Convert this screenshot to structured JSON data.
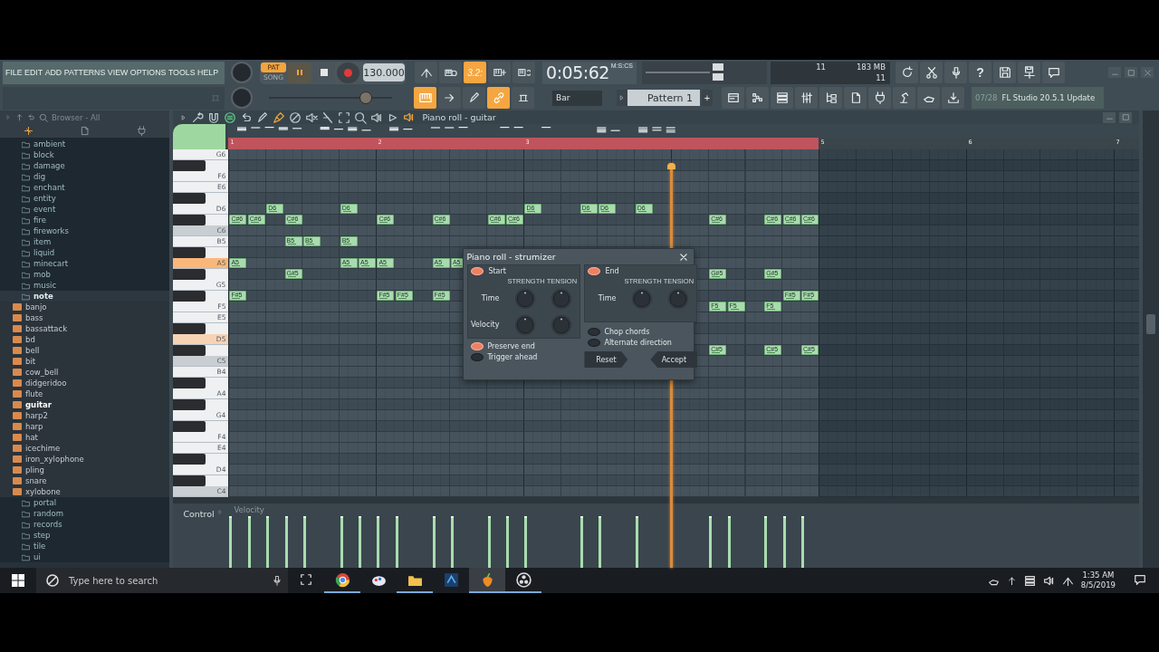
{
  "toolbar": {
    "menu": [
      "FILE",
      "EDIT",
      "ADD",
      "PATTERNS",
      "VIEW",
      "OPTIONS",
      "TOOLS",
      "HELP"
    ],
    "modes": [
      {
        "label": "PAT",
        "selected": true
      },
      {
        "label": "SONG",
        "selected": false
      }
    ],
    "playing": true,
    "tempo": "130.000",
    "toggles_top": [
      {
        "on": false
      },
      {
        "on": false
      },
      {
        "on": true,
        "label": "3.2:"
      },
      {
        "on": false
      },
      {
        "on": false
      }
    ],
    "time": {
      "value": "0:05:62",
      "unit": "M:S:CS"
    },
    "monitor": {
      "polyphony": "11",
      "memory": "183 MB",
      "voices": "11"
    },
    "help_label": "?",
    "master_pitch": {
      "level": 0.78
    },
    "toggles_bottom": [
      {
        "on": true
      },
      {
        "on": false
      },
      {
        "on": false
      },
      {
        "on": true
      },
      {
        "on": false
      }
    ],
    "snap": "Bar",
    "pattern": "Pattern 1",
    "plus": "+",
    "news": {
      "counter": "07/28",
      "text": "FL Studio 20.5.1 Update"
    }
  },
  "browser": {
    "title": "Browser - All",
    "items": [
      {
        "kind": "folder",
        "label": "ambient",
        "selected": false
      },
      {
        "kind": "folder",
        "label": "block",
        "selected": false
      },
      {
        "kind": "folder",
        "label": "damage",
        "selected": false
      },
      {
        "kind": "folder",
        "label": "dig",
        "selected": false
      },
      {
        "kind": "folder",
        "label": "enchant",
        "selected": false
      },
      {
        "kind": "folder",
        "label": "entity",
        "selected": false
      },
      {
        "kind": "folder",
        "label": "event",
        "selected": false
      },
      {
        "kind": "folder",
        "label": "fire",
        "selected": false
      },
      {
        "kind": "folder",
        "label": "fireworks",
        "selected": false
      },
      {
        "kind": "folder",
        "label": "item",
        "selected": false
      },
      {
        "kind": "folder",
        "label": "liquid",
        "selected": false
      },
      {
        "kind": "folder",
        "label": "minecart",
        "selected": false
      },
      {
        "kind": "folder",
        "label": "mob",
        "selected": false
      },
      {
        "kind": "folder",
        "label": "music",
        "selected": false
      },
      {
        "kind": "folder",
        "label": "note",
        "selected": true,
        "children": [
          {
            "kind": "sample",
            "label": "banjo",
            "selected": false
          },
          {
            "kind": "sample",
            "label": "bass",
            "selected": false
          },
          {
            "kind": "sample",
            "label": "bassattack",
            "selected": false
          },
          {
            "kind": "sample",
            "label": "bd",
            "selected": false
          },
          {
            "kind": "sample",
            "label": "bell",
            "selected": false
          },
          {
            "kind": "sample",
            "label": "bit",
            "selected": false
          },
          {
            "kind": "sample",
            "label": "cow_bell",
            "selected": false
          },
          {
            "kind": "sample",
            "label": "didgeridoo",
            "selected": false
          },
          {
            "kind": "sample",
            "label": "flute",
            "selected": false
          },
          {
            "kind": "sample",
            "label": "guitar",
            "selected": true
          },
          {
            "kind": "sample",
            "label": "harp2",
            "selected": false
          },
          {
            "kind": "sample",
            "label": "harp",
            "selected": false
          },
          {
            "kind": "sample",
            "label": "hat",
            "selected": false
          },
          {
            "kind": "sample",
            "label": "icechime",
            "selected": false
          },
          {
            "kind": "sample",
            "label": "iron_xylophone",
            "selected": false
          },
          {
            "kind": "sample",
            "label": "pling",
            "selected": false
          },
          {
            "kind": "sample",
            "label": "snare",
            "selected": false
          },
          {
            "kind": "sample",
            "label": "xylobone",
            "selected": false
          }
        ]
      },
      {
        "kind": "folder",
        "label": "portal",
        "selected": false
      },
      {
        "kind": "folder",
        "label": "random",
        "selected": false
      },
      {
        "kind": "folder",
        "label": "records",
        "selected": false
      },
      {
        "kind": "folder",
        "label": "step",
        "selected": false
      },
      {
        "kind": "folder",
        "label": "tile",
        "selected": false
      },
      {
        "kind": "folder",
        "label": "ui",
        "selected": false
      }
    ]
  },
  "piano_roll": {
    "title": "Piano roll - guitar",
    "tools": [
      {
        "on": false
      },
      {
        "on": false
      },
      {
        "on": true
      },
      {
        "on": false
      },
      {
        "on": false
      },
      {
        "on": true
      },
      {
        "on": false
      },
      {
        "on": false
      },
      {
        "on": false
      },
      {
        "on": false
      },
      {
        "on": false
      },
      {
        "on": false
      },
      {
        "on": false
      }
    ],
    "bars": [
      "1",
      "2",
      "3",
      "5",
      "6",
      "7"
    ],
    "rows": [
      {
        "key": {
          "kind": "white",
          "label": "G6",
          "pressed": false,
          "marked": false
        }
      },
      {
        "key": {
          "kind": "black",
          "pressed": false,
          "marked": false
        }
      },
      {
        "key": {
          "kind": "white",
          "label": "F6",
          "pressed": false,
          "marked": false
        }
      },
      {
        "key": {
          "kind": "white",
          "label": "E6",
          "pressed": false,
          "marked": false
        }
      },
      {
        "key": {
          "kind": "black",
          "pressed": false,
          "marked": false
        }
      },
      {
        "key": {
          "kind": "white",
          "label": "D6",
          "pressed": false,
          "marked": false
        },
        "notes": [
          {
            "label": "D6"
          },
          {
            "label": "D6"
          },
          {
            "label": "D6"
          },
          {
            "label": "D6"
          },
          {
            "label": "D6"
          },
          {
            "label": "D6"
          }
        ]
      },
      {
        "key": {
          "kind": "black",
          "pressed": false,
          "marked": false
        },
        "notes": [
          {
            "label": "C#6"
          },
          {
            "label": "C#6"
          },
          {
            "label": "C#6"
          },
          {
            "label": "C#6"
          },
          {
            "label": "C#6"
          },
          {
            "label": "C#6"
          },
          {
            "label": "C#6"
          },
          {
            "label": "C#6"
          },
          {
            "label": "C#6"
          },
          {
            "label": "C#6"
          },
          {
            "label": "C#6"
          }
        ]
      },
      {
        "key": {
          "kind": "octave",
          "label": "C6",
          "pressed": false,
          "marked": false
        }
      },
      {
        "key": {
          "kind": "white",
          "label": "B5",
          "pressed": false,
          "marked": false
        },
        "notes": [
          {
            "label": "B5"
          },
          {
            "label": "B5"
          },
          {
            "label": "B5"
          }
        ]
      },
      {
        "key": {
          "kind": "black",
          "pressed": false,
          "marked": false
        }
      },
      {
        "key": {
          "kind": "white",
          "label": "A5",
          "pressed": true
        },
        "notes": [
          {
            "label": "A5"
          },
          {
            "label": "A5"
          },
          {
            "label": "A5"
          },
          {
            "label": "A5"
          },
          {
            "label": "A5"
          },
          {
            "label": "A5"
          }
        ]
      },
      {
        "key": {
          "kind": "black",
          "pressed": false,
          "marked": false
        },
        "notes": [
          {
            "label": "G#5"
          },
          {
            "label": "G#5"
          },
          {
            "label": "G#5"
          }
        ]
      },
      {
        "key": {
          "kind": "white",
          "label": "G5",
          "pressed": false,
          "marked": false
        }
      },
      {
        "key": {
          "kind": "black",
          "pressed": false,
          "marked": false
        },
        "notes": [
          {
            "label": "F#5"
          },
          {
            "label": "F#5"
          },
          {
            "label": "F#5"
          },
          {
            "label": "F#5"
          },
          {
            "label": "F#5"
          },
          {
            "label": "F#5"
          }
        ]
      },
      {
        "key": {
          "kind": "white",
          "label": "F5",
          "pressed": false,
          "marked": false
        },
        "notes": [
          {
            "label": "F5"
          },
          {
            "label": "F5"
          },
          {
            "label": "F5"
          }
        ]
      },
      {
        "key": {
          "kind": "white",
          "label": "E5",
          "pressed": false,
          "marked": false
        }
      },
      {
        "key": {
          "kind": "black",
          "pressed": false,
          "marked": false
        }
      },
      {
        "key": {
          "kind": "white",
          "label": "D5",
          "pressed": false,
          "marked": true
        }
      },
      {
        "key": {
          "kind": "black",
          "pressed": false,
          "marked": false
        },
        "notes": [
          {
            "label": "C#5"
          },
          {
            "label": "C#5"
          },
          {
            "label": "C#5"
          }
        ]
      },
      {
        "key": {
          "kind": "octave",
          "label": "C5",
          "pressed": false,
          "marked": false
        }
      },
      {
        "key": {
          "kind": "white",
          "label": "B4",
          "pressed": false,
          "marked": false
        }
      },
      {
        "key": {
          "kind": "black",
          "pressed": false,
          "marked": false
        }
      },
      {
        "key": {
          "kind": "white",
          "label": "A4",
          "pressed": false,
          "marked": false
        }
      },
      {
        "key": {
          "kind": "black",
          "pressed": false,
          "marked": false
        }
      },
      {
        "key": {
          "kind": "white",
          "label": "G4",
          "pressed": false,
          "marked": false
        }
      },
      {
        "key": {
          "kind": "black",
          "pressed": false,
          "marked": false
        }
      },
      {
        "key": {
          "kind": "white",
          "label": "F4",
          "pressed": false,
          "marked": false
        }
      },
      {
        "key": {
          "kind": "white",
          "label": "E4",
          "pressed": false,
          "marked": false
        }
      },
      {
        "key": {
          "kind": "black",
          "pressed": false,
          "marked": false
        }
      },
      {
        "key": {
          "kind": "white",
          "label": "D4",
          "pressed": false,
          "marked": false
        }
      },
      {
        "key": {
          "kind": "black",
          "pressed": false,
          "marked": false
        }
      },
      {
        "key": {
          "kind": "octave",
          "label": "C4",
          "pressed": false,
          "marked": false
        }
      }
    ],
    "control": {
      "label": "Control",
      "target": "Velocity"
    }
  },
  "strumizer": {
    "title": "Piano roll - strumizer",
    "start": {
      "label": "Start",
      "on": true,
      "columns": [
        "STRENGTH",
        "TENSION"
      ],
      "rows": [
        {
          "label": "Time"
        },
        {
          "label": "Velocity"
        }
      ]
    },
    "end": {
      "label": "End",
      "on": true,
      "columns": [
        "STRENGTH",
        "TENSION"
      ],
      "rows": [
        {
          "label": "Time"
        }
      ]
    },
    "options_left": [
      {
        "label": "Preserve end",
        "checked": true
      },
      {
        "label": "Trigger ahead",
        "checked": false
      }
    ],
    "options_right": [
      {
        "label": "Chop chords",
        "checked": false
      },
      {
        "label": "Alternate direction",
        "checked": false
      }
    ],
    "buttons": [
      "Reset",
      "Accept"
    ]
  },
  "taskbar": {
    "search_placeholder": "Type here to search",
    "apps": [
      {
        "running": true,
        "selected": false
      },
      {
        "running": false,
        "selected": false
      },
      {
        "running": true,
        "selected": false
      },
      {
        "running": false,
        "selected": false
      },
      {
        "running": true,
        "selected": true
      },
      {
        "running": true,
        "selected": false
      }
    ],
    "time": "1:35 AM",
    "date": "8/5/2019"
  }
}
